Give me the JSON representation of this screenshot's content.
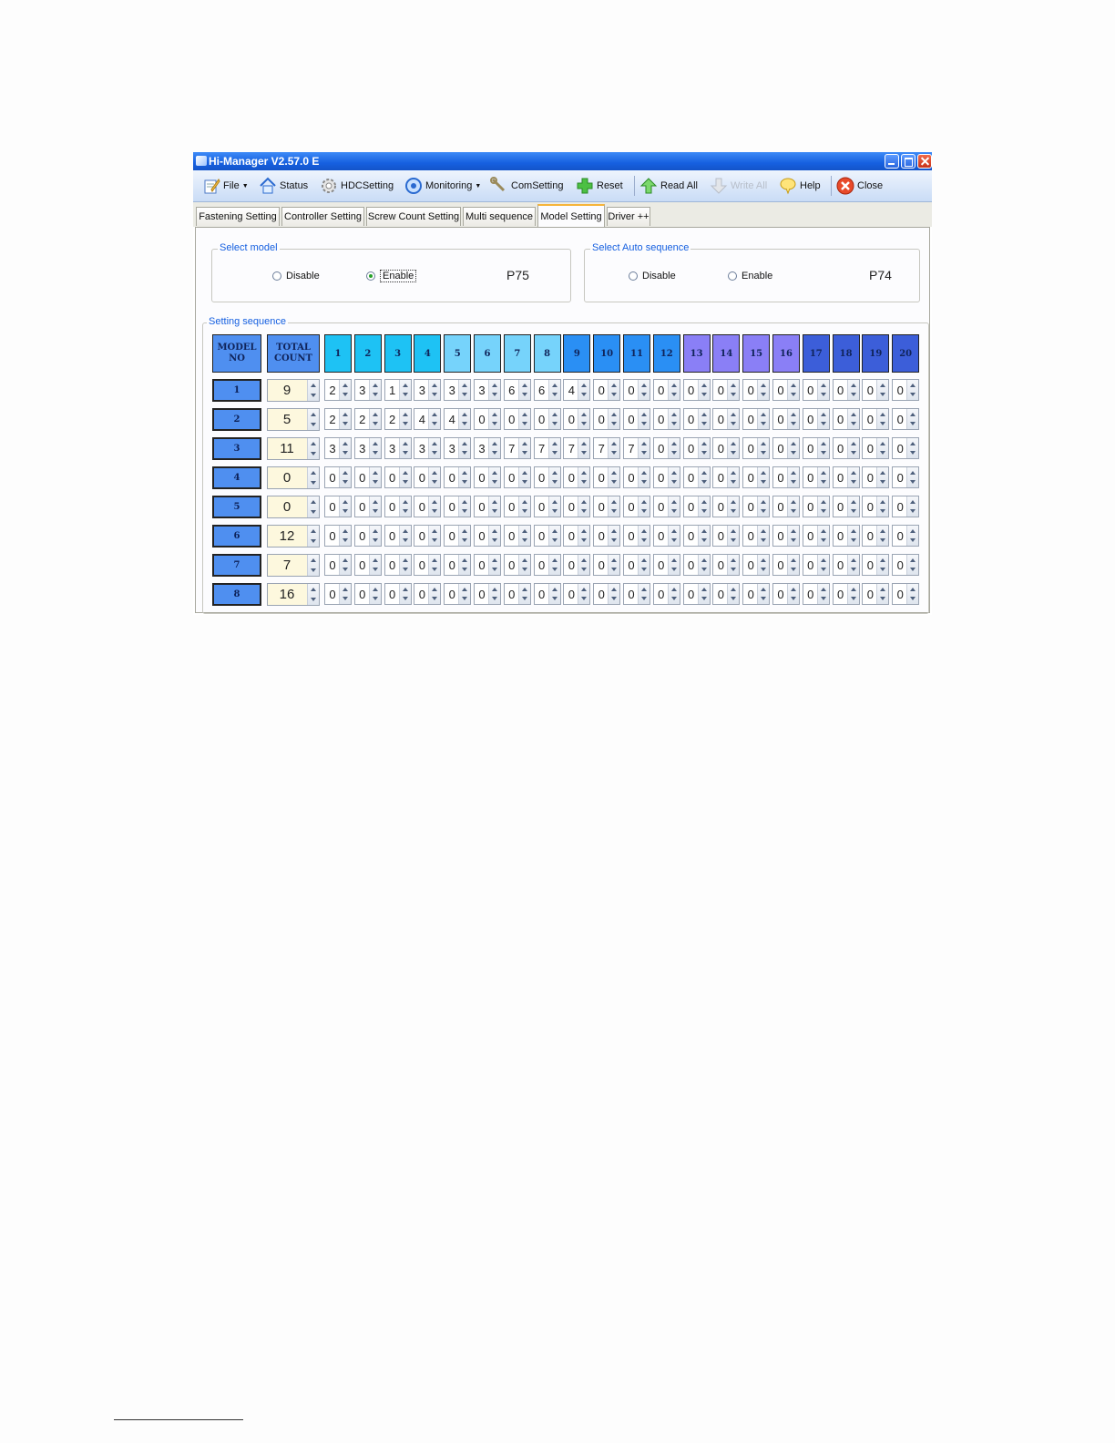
{
  "window": {
    "title": "Hi-Manager V2.57.0 E"
  },
  "toolbar": {
    "file": "File",
    "status": "Status",
    "hdc_setting": "HDCSetting",
    "monitoring": "Monitoring",
    "com_setting": "ComSetting",
    "reset": "Reset",
    "read_all": "Read All",
    "write_all": "Write All",
    "help": "Help",
    "close": "Close"
  },
  "tabs": [
    "Fastening Setting",
    "Controller Setting",
    "Screw Count Setting",
    "Multi sequence",
    "Model Setting",
    "Driver ++"
  ],
  "active_tab": "Model Setting",
  "select_model": {
    "title": "Select model",
    "disable_label": "Disable",
    "enable_label": "Enable",
    "selected": "Enable",
    "param_code": "P75"
  },
  "select_auto_sequence": {
    "title": "Select Auto sequence",
    "disable_label": "Disable",
    "enable_label": "Enable",
    "selected": "none",
    "param_code": "P74"
  },
  "setting_sequence": {
    "title": "Setting sequence",
    "model_no_header": [
      "MODEL",
      "NO"
    ],
    "total_count_header": [
      "TOTAL",
      "COUNT"
    ],
    "step_headers": [
      "1",
      "2",
      "3",
      "4",
      "5",
      "6",
      "7",
      "8",
      "9",
      "10",
      "11",
      "12",
      "13",
      "14",
      "15",
      "16",
      "17",
      "18",
      "19",
      "20"
    ],
    "header_colors": [
      "#1ec2f4",
      "#1ec2f4",
      "#1ec2f4",
      "#1ec2f4",
      "#76d3fb",
      "#76d3fb",
      "#76d3fb",
      "#76d3fb",
      "#2a8ff4",
      "#2a8ff4",
      "#2a8ff4",
      "#2a8ff4",
      "#8a7ff6",
      "#8a7ff6",
      "#8a7ff6",
      "#8a7ff6",
      "#3c5ed9",
      "#3c5ed9",
      "#3c5ed9",
      "#3c5ed9"
    ],
    "rows": [
      {
        "model": "1",
        "total": "9",
        "steps": [
          "2",
          "3",
          "1",
          "3",
          "3",
          "3",
          "6",
          "6",
          "4",
          "0",
          "0",
          "0",
          "0",
          "0",
          "0",
          "0",
          "0",
          "0",
          "0",
          "0"
        ]
      },
      {
        "model": "2",
        "total": "5",
        "steps": [
          "2",
          "2",
          "2",
          "4",
          "4",
          "0",
          "0",
          "0",
          "0",
          "0",
          "0",
          "0",
          "0",
          "0",
          "0",
          "0",
          "0",
          "0",
          "0",
          "0"
        ]
      },
      {
        "model": "3",
        "total": "11",
        "steps": [
          "3",
          "3",
          "3",
          "3",
          "3",
          "3",
          "7",
          "7",
          "7",
          "7",
          "7",
          "0",
          "0",
          "0",
          "0",
          "0",
          "0",
          "0",
          "0",
          "0"
        ]
      },
      {
        "model": "4",
        "total": "0",
        "steps": [
          "0",
          "0",
          "0",
          "0",
          "0",
          "0",
          "0",
          "0",
          "0",
          "0",
          "0",
          "0",
          "0",
          "0",
          "0",
          "0",
          "0",
          "0",
          "0",
          "0"
        ]
      },
      {
        "model": "5",
        "total": "0",
        "steps": [
          "0",
          "0",
          "0",
          "0",
          "0",
          "0",
          "0",
          "0",
          "0",
          "0",
          "0",
          "0",
          "0",
          "0",
          "0",
          "0",
          "0",
          "0",
          "0",
          "0"
        ]
      },
      {
        "model": "6",
        "total": "12",
        "steps": [
          "0",
          "0",
          "0",
          "0",
          "0",
          "0",
          "0",
          "0",
          "0",
          "0",
          "0",
          "0",
          "0",
          "0",
          "0",
          "0",
          "0",
          "0",
          "0",
          "0"
        ]
      },
      {
        "model": "7",
        "total": "7",
        "steps": [
          "0",
          "0",
          "0",
          "0",
          "0",
          "0",
          "0",
          "0",
          "0",
          "0",
          "0",
          "0",
          "0",
          "0",
          "0",
          "0",
          "0",
          "0",
          "0",
          "0"
        ]
      },
      {
        "model": "8",
        "total": "16",
        "steps": [
          "0",
          "0",
          "0",
          "0",
          "0",
          "0",
          "0",
          "0",
          "0",
          "0",
          "0",
          "0",
          "0",
          "0",
          "0",
          "0",
          "0",
          "0",
          "0",
          "0"
        ]
      }
    ]
  },
  "icons": {
    "file": "notepad-pencil-icon",
    "status": "house-icon",
    "hdc_setting": "gear-icon",
    "monitoring": "magnifier-icon",
    "com_setting": "wrench-icon",
    "reset": "green-plus-icon",
    "read_all": "up-arrow-icon",
    "write_all": "down-arrow-icon",
    "help": "speech-bubble-icon",
    "close": "red-x-icon"
  }
}
